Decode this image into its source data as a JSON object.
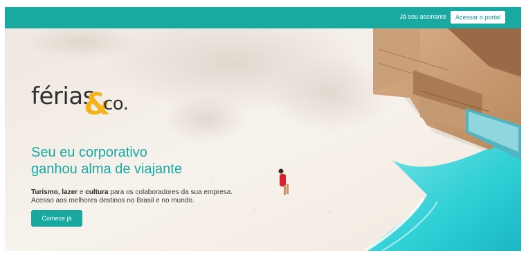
{
  "header": {
    "already_subscriber": "Já sou assinante",
    "portal_button": "Acessar o portal"
  },
  "logo": {
    "word1": "férias",
    "amp": "&",
    "word2": "co."
  },
  "hero": {
    "headline_line1": "Seu eu corporativo",
    "headline_line2": "ganhou alma de viajante",
    "sub_bold1": "Turismo, lazer",
    "sub_mid": " e ",
    "sub_bold2": "cultura",
    "sub_rest": " para os colaboradores da sua empresa.",
    "sub_line2": "Acesso aos melhores destinos no Brasil e no mundo.",
    "cta": "Comece já"
  },
  "colors": {
    "brand_teal": "#1aa9a0",
    "logo_amp": "#f6b21b",
    "sea": "#2fd0d6"
  }
}
